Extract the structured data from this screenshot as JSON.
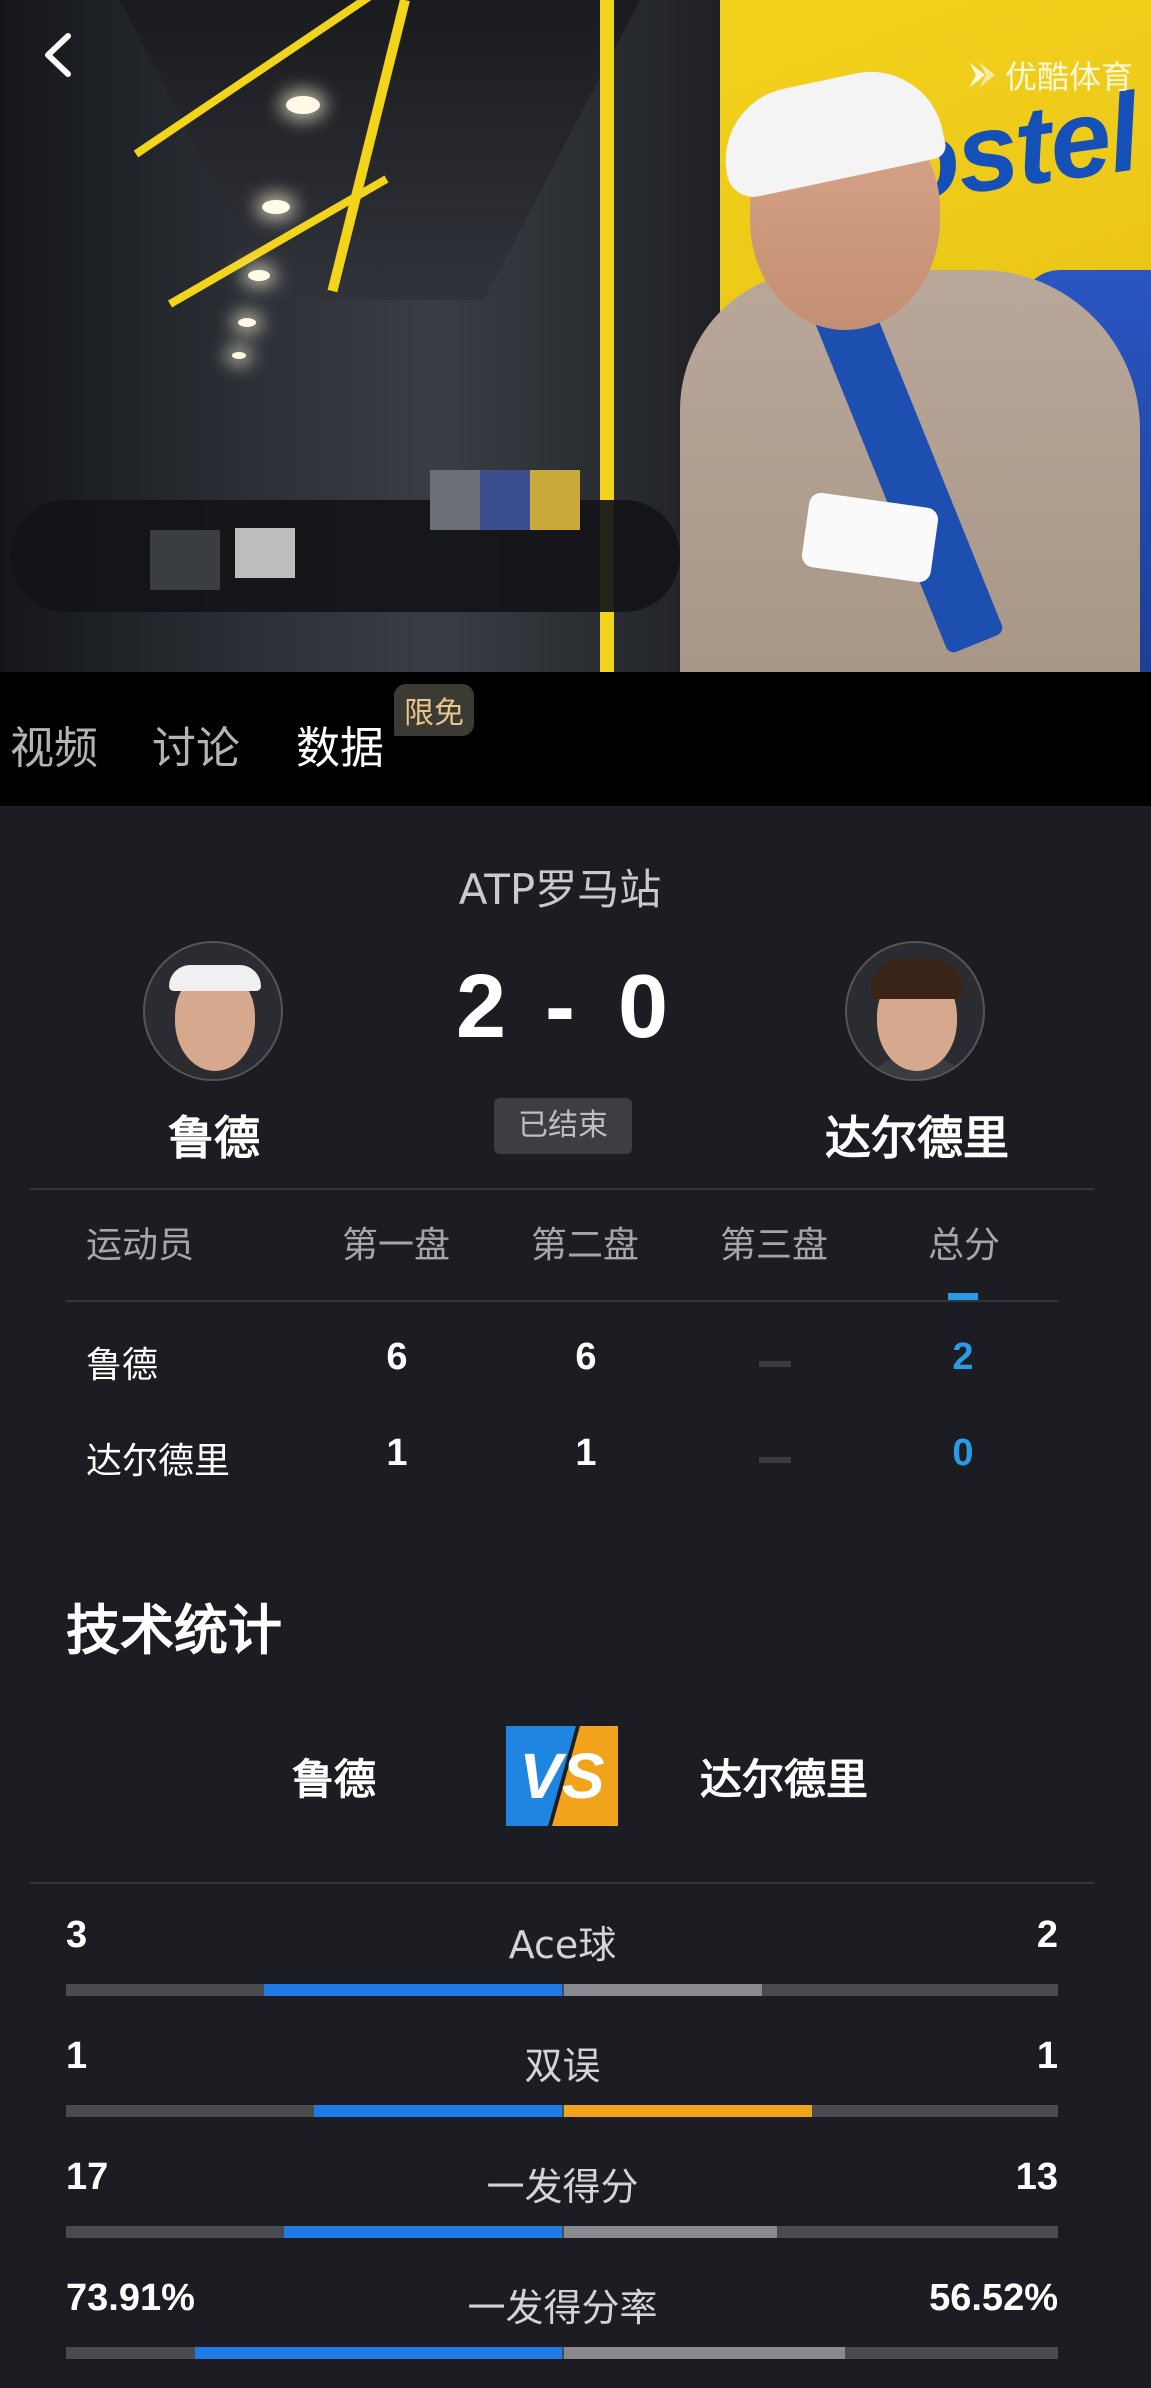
{
  "brand": {
    "logo_text": "优酷体育",
    "icon": "play-chevron-icon"
  },
  "tabs": [
    {
      "label": "视频",
      "active": false
    },
    {
      "label": "讨论",
      "active": false
    },
    {
      "label": "数据",
      "active": true,
      "badge": "限免"
    }
  ],
  "match": {
    "title": "ATP罗马站",
    "status": "已结束",
    "home": {
      "name": "鲁德",
      "score": "2"
    },
    "away": {
      "name": "达尔德里",
      "score": "0"
    },
    "score_separator": "-"
  },
  "sets_table": {
    "headers": [
      "运动员",
      "第一盘",
      "第二盘",
      "第三盘",
      "总分"
    ],
    "rows": [
      {
        "name": "鲁德",
        "set1": "6",
        "set2": "6",
        "set3": "",
        "total": "2"
      },
      {
        "name": "达尔德里",
        "set1": "1",
        "set2": "1",
        "set3": "",
        "total": "0"
      }
    ]
  },
  "tech_stats": {
    "title": "技术统计",
    "home_name": "鲁德",
    "away_name": "达尔德里",
    "vs_label": "VS",
    "items": [
      {
        "label": "Ace球",
        "home": "3",
        "away": "2",
        "home_share": 0.3,
        "away_share": 0.2,
        "away_color": "#8a8a8e"
      },
      {
        "label": "双误",
        "home": "1",
        "away": "1",
        "home_share": 0.25,
        "away_share": 0.25,
        "away_color": "#f2a31c"
      },
      {
        "label": "一发得分",
        "home": "17",
        "away": "13",
        "home_share": 0.28,
        "away_share": 0.215,
        "away_color": "#8a8a8e"
      },
      {
        "label": "一发得分率",
        "home": "73.91%",
        "away": "56.52%",
        "home_share": 0.37,
        "away_share": 0.283,
        "away_color": "#8a8a8e"
      }
    ]
  },
  "colors": {
    "home_bar": "#1e7be6",
    "total_score": "#2a9be6",
    "track": "#4a4b50"
  }
}
